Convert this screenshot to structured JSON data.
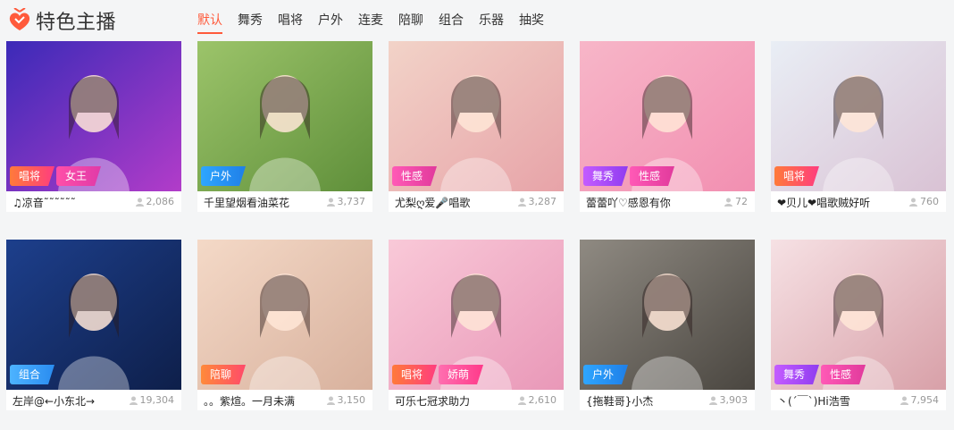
{
  "header": {
    "title": "特色主播",
    "tabs": [
      {
        "label": "默认",
        "active": true
      },
      {
        "label": "舞秀"
      },
      {
        "label": "唱将"
      },
      {
        "label": "户外"
      },
      {
        "label": "连麦"
      },
      {
        "label": "陪聊"
      },
      {
        "label": "组合"
      },
      {
        "label": "乐器"
      },
      {
        "label": "抽奖"
      }
    ]
  },
  "colors": {
    "accent": "#ff5a3b",
    "tag_gradients": {
      "唱将": [
        "#ff7a3a",
        "#ff3d7f"
      ],
      "女王": [
        "#ff4fa8",
        "#e03aa8"
      ],
      "户外": [
        "#2ea6ff",
        "#1f7fe8"
      ],
      "性感": [
        "#ff5ab6",
        "#e13a9c"
      ],
      "舞秀": [
        "#c45cff",
        "#8f3cf0"
      ],
      "组合": [
        "#4db3ff",
        "#2a8cf0"
      ],
      "陪聊": [
        "#ff8a3a",
        "#ff4a6a"
      ],
      "娇萌": [
        "#ff6fb0",
        "#ff3a8a"
      ]
    }
  },
  "streamers": [
    {
      "name": "♫凉音˜˜˜˜˜˜",
      "viewers": "2,086",
      "tags": [
        "唱将",
        "女王"
      ],
      "scene": [
        "#3b2ab8",
        "#b23cc9"
      ]
    },
    {
      "name": "千里望烟看油菜花",
      "viewers": "3,737",
      "tags": [
        "户外"
      ],
      "scene": [
        "#9cc46a",
        "#5f8f3a"
      ]
    },
    {
      "name": "尤梨ღ爱🎤唱歌",
      "viewers": "3,287",
      "tags": [
        "性感"
      ],
      "scene": [
        "#f2d3c8",
        "#e7a3a8"
      ]
    },
    {
      "name": "蕾蕾吖♡感恩有你",
      "viewers": "72",
      "tags": [
        "舞秀",
        "性感"
      ],
      "scene": [
        "#f7b6c8",
        "#f28fb1"
      ]
    },
    {
      "name": "❤贝儿❤唱歌贼好听",
      "viewers": "760",
      "tags": [
        "唱将"
      ],
      "scene": [
        "#e9eef5",
        "#d9c2d4"
      ]
    },
    {
      "name": "左岸@←小东北→",
      "viewers": "19,304",
      "tags": [
        "组合"
      ],
      "scene": [
        "#1d3f8c",
        "#0e1f4a"
      ]
    },
    {
      "name": "。。紫煊。一月未满",
      "viewers": "3,150",
      "tags": [
        "陪聊"
      ],
      "scene": [
        "#f4d9c7",
        "#d8b19d"
      ]
    },
    {
      "name": "可乐七冠求助力",
      "viewers": "2,610",
      "tags": [
        "唱将",
        "娇萌"
      ],
      "scene": [
        "#f9c9d8",
        "#e998b8"
      ]
    },
    {
      "name": "{拖鞋哥}小杰",
      "viewers": "3,903",
      "tags": [
        "户外"
      ],
      "scene": [
        "#8f8a82",
        "#4a4640"
      ]
    },
    {
      "name": "丶(ˊ￣ˋ)Hi浩雪",
      "viewers": "7,954",
      "tags": [
        "舞秀",
        "性感"
      ],
      "scene": [
        "#f6e1e4",
        "#d8a0a8"
      ]
    }
  ]
}
